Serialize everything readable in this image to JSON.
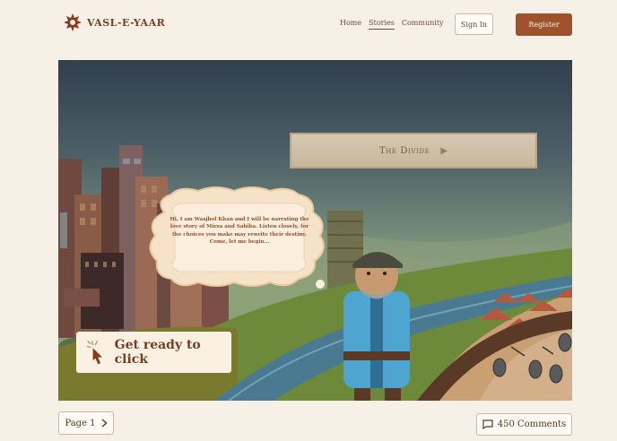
{
  "brand": {
    "name": "VASL-E-YAAR",
    "logo_icon": "star-knot-icon"
  },
  "nav": {
    "links": [
      {
        "label": "Home",
        "active": false
      },
      {
        "label": "Stories",
        "active": true
      },
      {
        "label": "Community",
        "active": false
      }
    ],
    "signin_label": "Sign In",
    "register_label": "Register"
  },
  "scene": {
    "chapter_title": "The Divide",
    "chapter_arrow": "▶",
    "narration": "Hi, I am Wasjhol Khan and I will be narrating the love story of Mirza and Sahiba. Listen closely, for the choices you make may rewrite their destiny. Come, let me begin...",
    "cta_label": "Get ready to click",
    "cta_icon": "click-cursor-icon"
  },
  "footer": {
    "page_label": "Page 1",
    "page_icon": "chevron-right-icon",
    "comments_label": "450 Comments",
    "comments_icon": "comment-icon"
  },
  "colors": {
    "accent": "#a0522d",
    "background": "#f7f0e6",
    "text": "#5a3b22"
  }
}
